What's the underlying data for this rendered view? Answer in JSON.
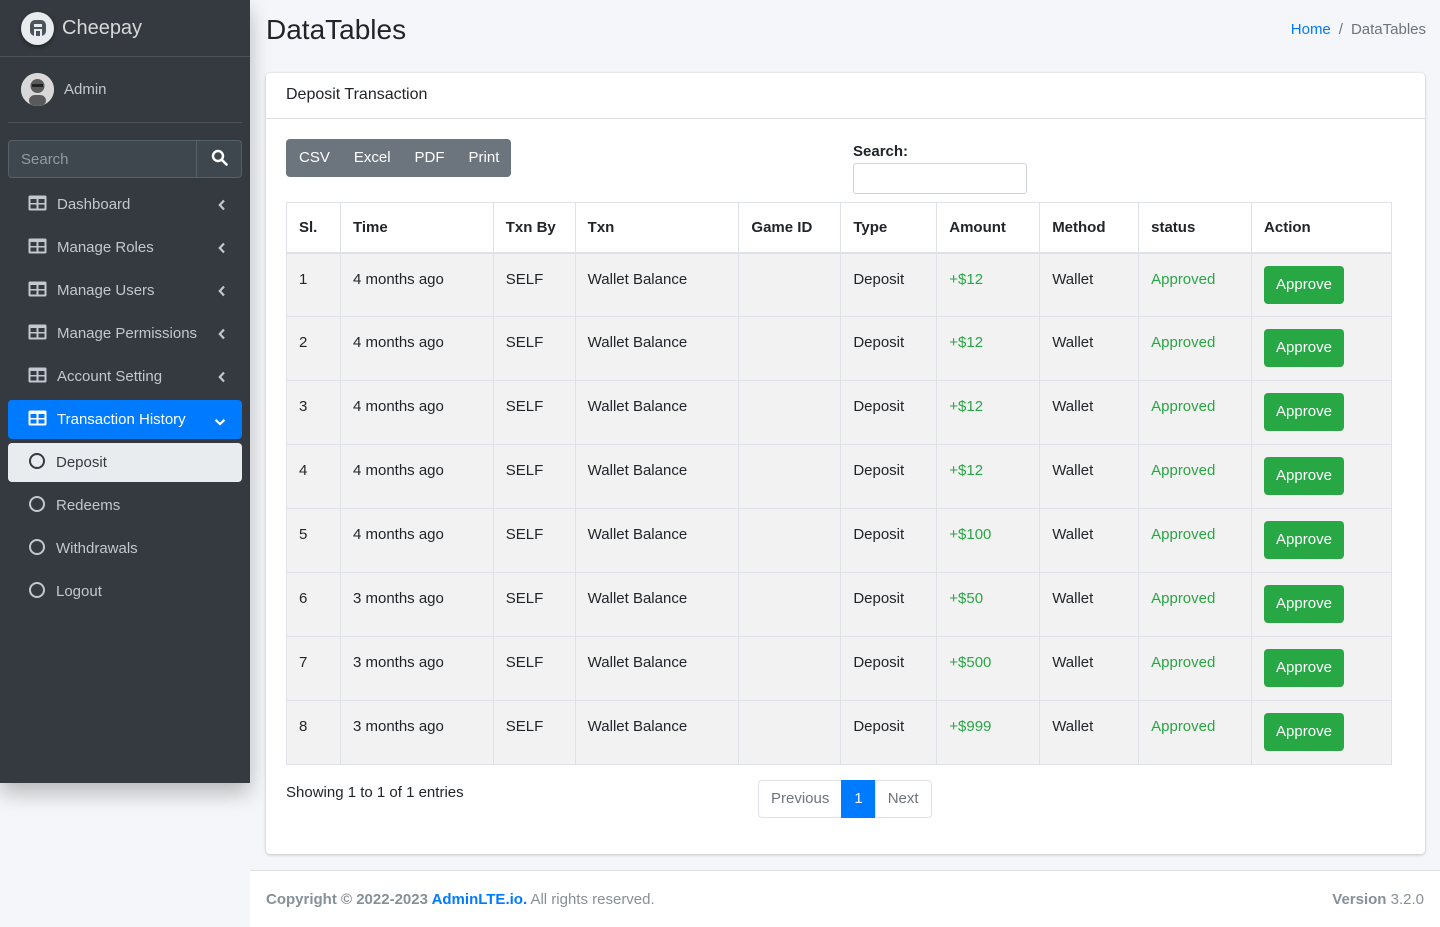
{
  "brand": {
    "name": "Cheepay"
  },
  "user": {
    "name": "Admin"
  },
  "sidebar_search": {
    "placeholder": "Search"
  },
  "nav": [
    {
      "label": "Dashboard",
      "icon": "table-icon",
      "state": "collapsed"
    },
    {
      "label": "Manage Roles",
      "icon": "table-icon",
      "state": "collapsed"
    },
    {
      "label": "Manage Users",
      "icon": "table-icon",
      "state": "collapsed"
    },
    {
      "label": "Manage Permissions",
      "icon": "table-icon",
      "state": "collapsed"
    },
    {
      "label": "Account Setting",
      "icon": "table-icon",
      "state": "collapsed"
    },
    {
      "label": "Transaction History",
      "icon": "table-icon",
      "state": "expanded-active"
    },
    {
      "label": "Deposit",
      "icon": "circle-icon",
      "state": "selected"
    },
    {
      "label": "Redeems",
      "icon": "circle-icon",
      "state": "normal"
    },
    {
      "label": "Withdrawals",
      "icon": "circle-icon",
      "state": "normal"
    },
    {
      "label": "Logout",
      "icon": "circle-icon",
      "state": "normal"
    }
  ],
  "header": {
    "title": "DataTables",
    "breadcrumb_home": "Home",
    "breadcrumb_current": "DataTables",
    "separator": "/"
  },
  "card": {
    "title": "Deposit Transaction"
  },
  "export_buttons": [
    "CSV",
    "Excel",
    "PDF",
    "Print"
  ],
  "search": {
    "label": "Search:"
  },
  "table": {
    "columns": [
      "Sl.",
      "Time",
      "Txn By",
      "Txn",
      "Game ID",
      "Type",
      "Amount",
      "Method",
      "status",
      "Action"
    ],
    "rows": [
      {
        "sl": "1",
        "time": "4 months ago",
        "by": "SELF",
        "txn": "Wallet Balance",
        "game": "",
        "type": "Deposit",
        "amount": "+$12",
        "method": "Wallet",
        "status": "Approved",
        "action": "Approve"
      },
      {
        "sl": "2",
        "time": "4 months ago",
        "by": "SELF",
        "txn": "Wallet Balance",
        "game": "",
        "type": "Deposit",
        "amount": "+$12",
        "method": "Wallet",
        "status": "Approved",
        "action": "Approve"
      },
      {
        "sl": "3",
        "time": "4 months ago",
        "by": "SELF",
        "txn": "Wallet Balance",
        "game": "",
        "type": "Deposit",
        "amount": "+$12",
        "method": "Wallet",
        "status": "Approved",
        "action": "Approve"
      },
      {
        "sl": "4",
        "time": "4 months ago",
        "by": "SELF",
        "txn": "Wallet Balance",
        "game": "",
        "type": "Deposit",
        "amount": "+$12",
        "method": "Wallet",
        "status": "Approved",
        "action": "Approve"
      },
      {
        "sl": "5",
        "time": "4 months ago",
        "by": "SELF",
        "txn": "Wallet Balance",
        "game": "",
        "type": "Deposit",
        "amount": "+$100",
        "method": "Wallet",
        "status": "Approved",
        "action": "Approve"
      },
      {
        "sl": "6",
        "time": "3 months ago",
        "by": "SELF",
        "txn": "Wallet Balance",
        "game": "",
        "type": "Deposit",
        "amount": "+$50",
        "method": "Wallet",
        "status": "Approved",
        "action": "Approve"
      },
      {
        "sl": "7",
        "time": "3 months ago",
        "by": "SELF",
        "txn": "Wallet Balance",
        "game": "",
        "type": "Deposit",
        "amount": "+$500",
        "method": "Wallet",
        "status": "Approved",
        "action": "Approve"
      },
      {
        "sl": "8",
        "time": "3 months ago",
        "by": "SELF",
        "txn": "Wallet Balance",
        "game": "",
        "type": "Deposit",
        "amount": "+$999",
        "method": "Wallet",
        "status": "Approved",
        "action": "Approve"
      }
    ]
  },
  "info": {
    "showing": "Showing 1 to 1 of 1 entries"
  },
  "pagination": {
    "previous": "Previous",
    "current": "1",
    "next": "Next"
  },
  "footer": {
    "copyright_prefix": "Copyright © 2022-2023 ",
    "link": "AdminLTE.io.",
    "suffix": " All rights reserved.",
    "version_label": "Version",
    "version": " 3.2.0"
  },
  "colors": {
    "sidebar_bg": "#343a40",
    "accent": "#007bff",
    "success": "#28a745",
    "export_bg": "#6c757d"
  }
}
